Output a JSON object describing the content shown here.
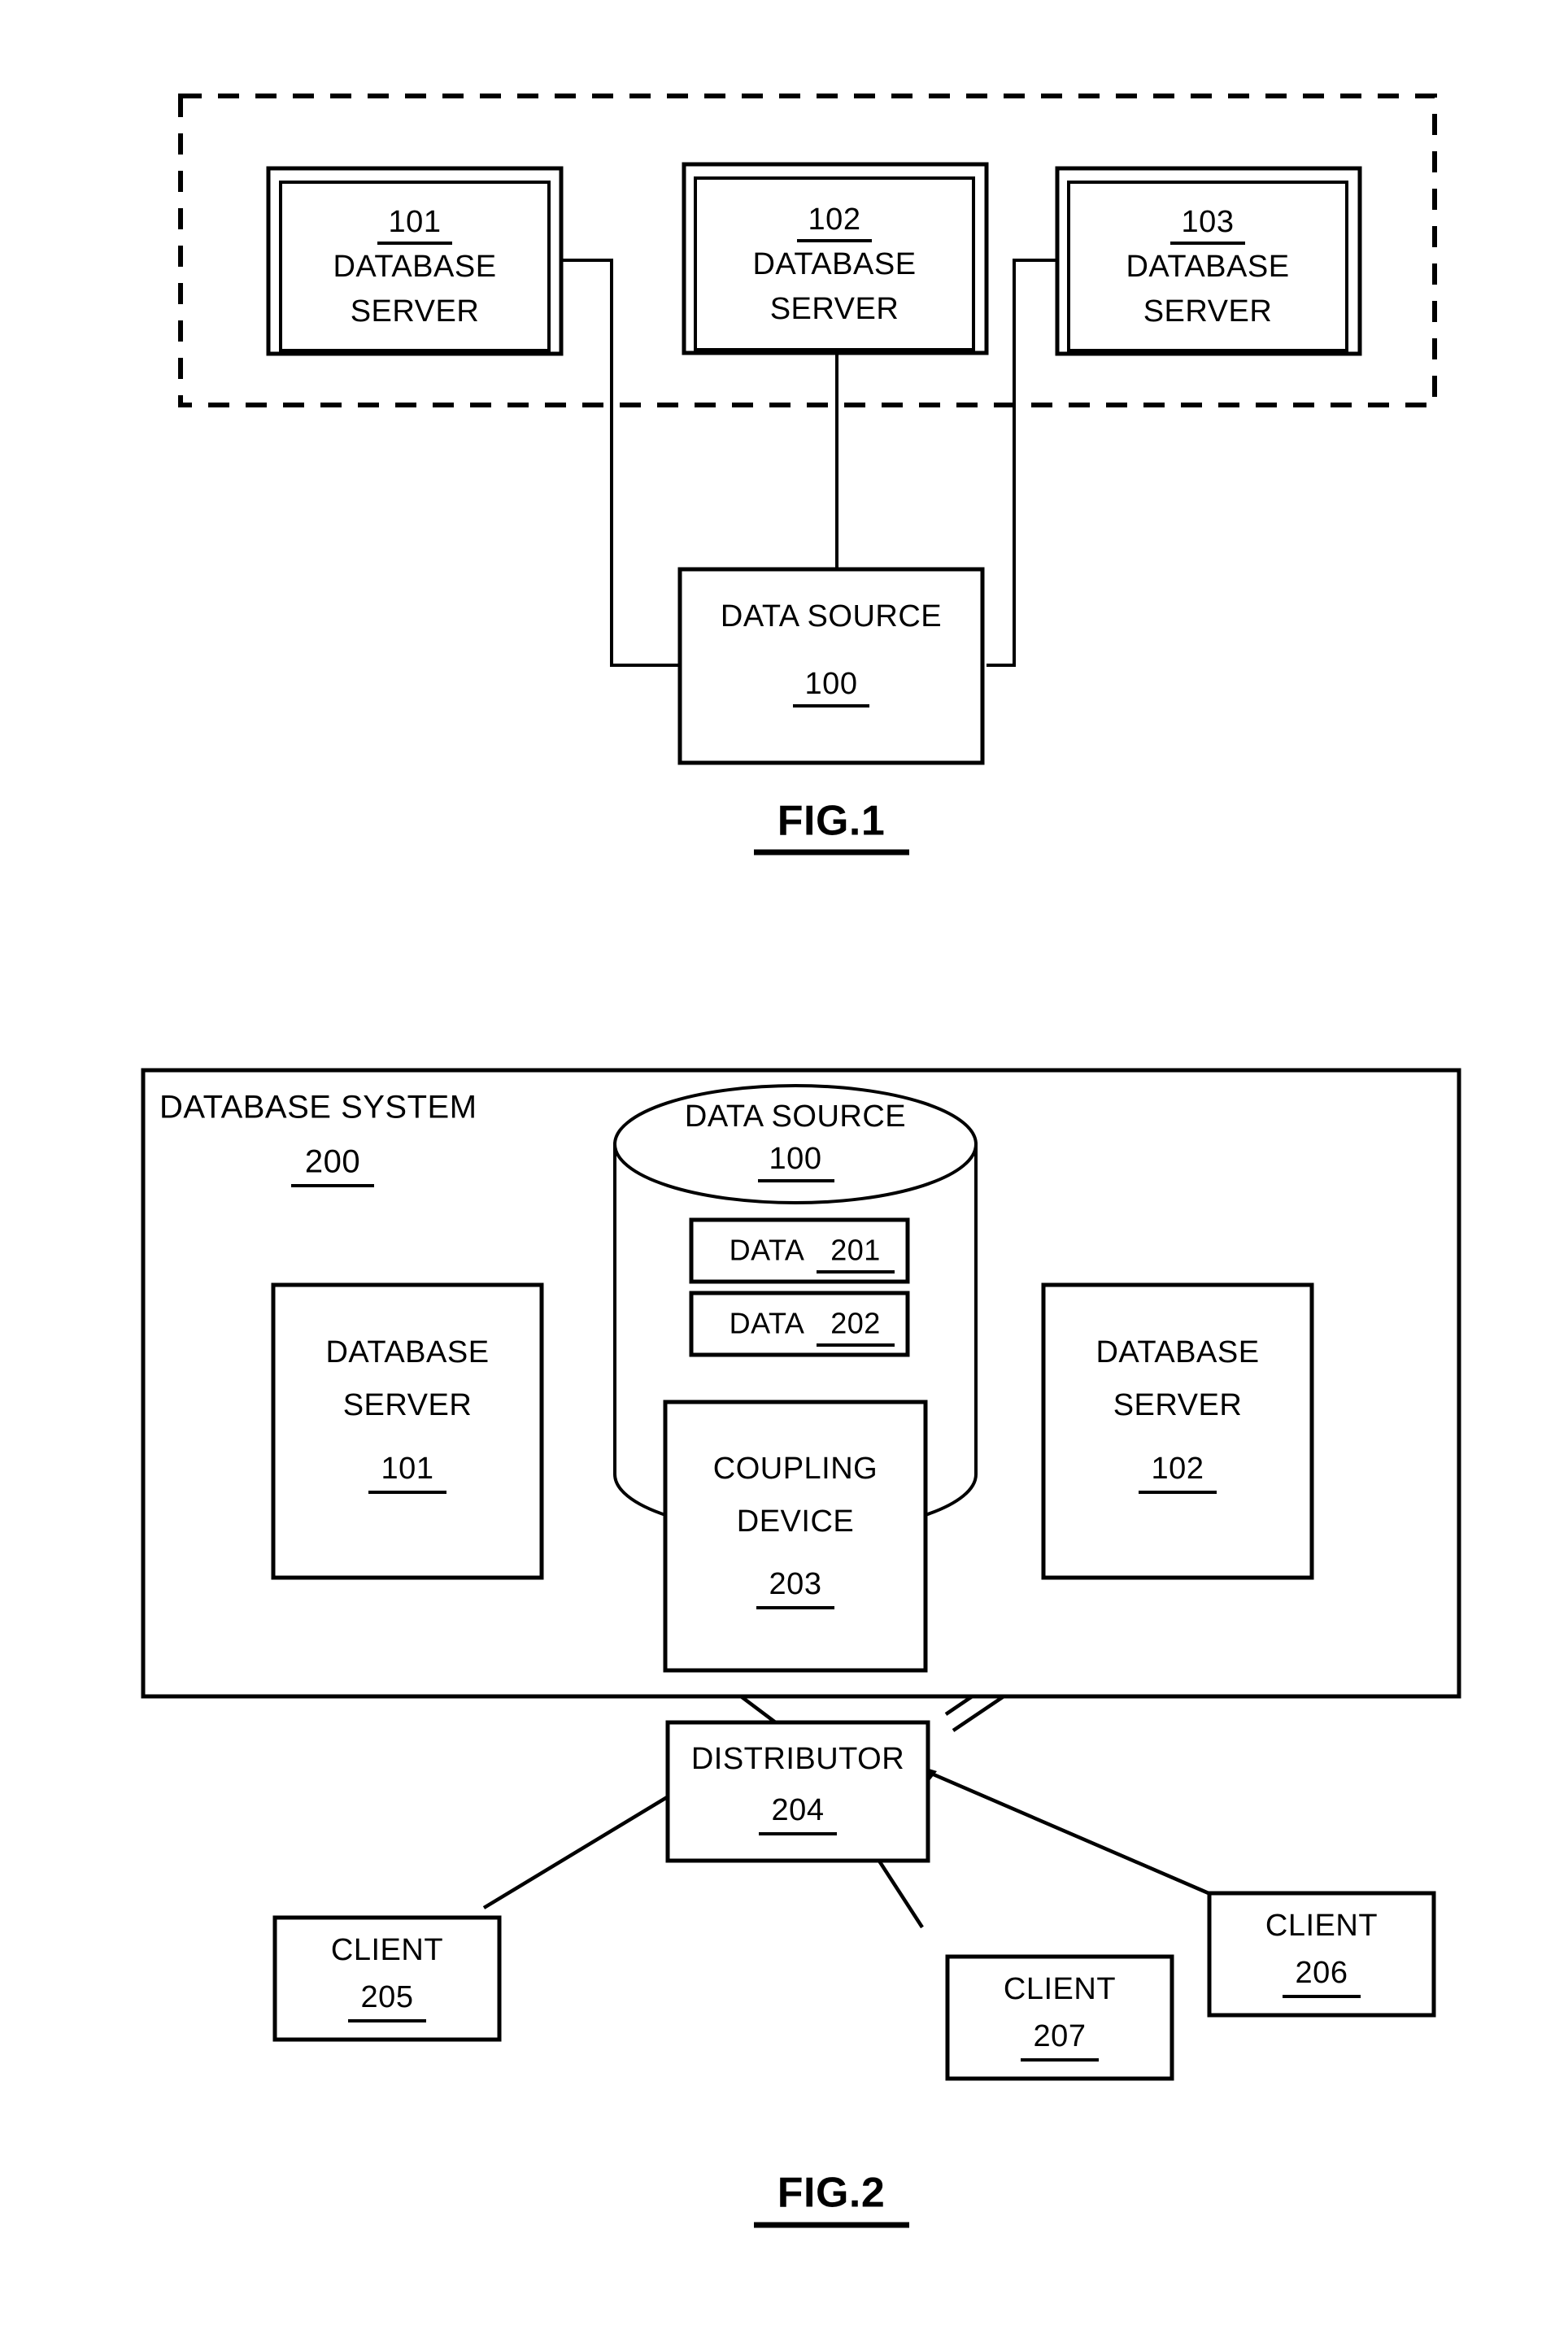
{
  "document": {
    "type": "patent-drawing-sheet",
    "background_color": "#ffffff",
    "ink_color": "#000000"
  },
  "figures": [
    {
      "id": "fig1",
      "caption": "FIG.1",
      "group_label": "",
      "nodes": [
        {
          "id": "srv101",
          "ref": "101",
          "line1": "DATABASE",
          "line2": "SERVER",
          "shape": "double-rect"
        },
        {
          "id": "srv102",
          "ref": "102",
          "line1": "DATABASE",
          "line2": "SERVER",
          "shape": "double-rect"
        },
        {
          "id": "srv103",
          "ref": "103",
          "line1": "DATABASE",
          "line2": "SERVER",
          "shape": "double-rect"
        },
        {
          "id": "ds100",
          "ref": "100",
          "line1": "DATA  SOURCE",
          "line2": "",
          "shape": "rect"
        }
      ],
      "edges": [
        {
          "from": "srv101",
          "to": "ds100",
          "style": "orthogonal",
          "arrow": "none"
        },
        {
          "from": "srv102",
          "to": "ds100",
          "style": "straight",
          "arrow": "none"
        },
        {
          "from": "srv103",
          "to": "ds100",
          "style": "orthogonal",
          "arrow": "none"
        }
      ]
    },
    {
      "id": "fig2",
      "caption": "FIG.2",
      "system": {
        "title": "DATABASE  SYSTEM",
        "ref": "200"
      },
      "nodes": [
        {
          "id": "ds100",
          "ref": "100",
          "line1": "DATA  SOURCE",
          "shape": "cylinder"
        },
        {
          "id": "data201",
          "label": "DATA",
          "ref": "201",
          "shape": "rect"
        },
        {
          "id": "data202",
          "label": "DATA",
          "ref": "202",
          "shape": "rect"
        },
        {
          "id": "srv101",
          "line1": "DATABASE",
          "line2": "SERVER",
          "ref": "101",
          "shape": "rect"
        },
        {
          "id": "srv102",
          "line1": "DATABASE",
          "line2": "SERVER",
          "ref": "102",
          "shape": "rect"
        },
        {
          "id": "coupling",
          "line1": "COUPLING",
          "line2": "DEVICE",
          "ref": "203",
          "shape": "rect"
        },
        {
          "id": "distributor",
          "line1": "DISTRIBUTOR",
          "ref": "204",
          "shape": "rect"
        },
        {
          "id": "client205",
          "line1": "CLIENT",
          "ref": "205",
          "shape": "rect"
        },
        {
          "id": "client206",
          "line1": "CLIENT",
          "ref": "206",
          "shape": "rect"
        },
        {
          "id": "client207",
          "line1": "CLIENT",
          "ref": "207",
          "shape": "rect"
        }
      ],
      "edges": [
        {
          "from": "srv101",
          "to": "data201",
          "arrow": "to"
        },
        {
          "from": "srv101",
          "to": "coupling",
          "arrow": "to"
        },
        {
          "from": "srv102",
          "to": "data201",
          "arrow": "to"
        },
        {
          "from": "srv102",
          "to": "data202",
          "arrow": "to"
        },
        {
          "from": "srv102",
          "to": "coupling",
          "arrow": "to"
        },
        {
          "from": "distributor",
          "to": "srv101",
          "arrow": "to"
        },
        {
          "from": "distributor",
          "to": "srv102",
          "arrow": "to"
        },
        {
          "from": "client205",
          "to": "distributor",
          "arrow": "to"
        },
        {
          "from": "client206",
          "to": "distributor",
          "arrow": "to"
        },
        {
          "from": "client207",
          "to": "distributor",
          "arrow": "to"
        }
      ]
    }
  ],
  "fig1": {
    "caption": "FIG.1",
    "servers": [
      {
        "ref": "101",
        "line1": "DATABASE",
        "line2": "SERVER"
      },
      {
        "ref": "102",
        "line1": "DATABASE",
        "line2": "SERVER"
      },
      {
        "ref": "103",
        "line1": "DATABASE",
        "line2": "SERVER"
      }
    ],
    "data_source": {
      "title": "DATA  SOURCE",
      "ref": "100"
    }
  },
  "fig2": {
    "caption": "FIG.2",
    "system_title": "DATABASE  SYSTEM",
    "system_ref": "200",
    "data_source": {
      "title": "DATA  SOURCE",
      "ref": "100"
    },
    "data_blocks": [
      {
        "label": "DATA",
        "ref": "201"
      },
      {
        "label": "DATA",
        "ref": "202"
      }
    ],
    "server_left": {
      "line1": "DATABASE",
      "line2": "SERVER",
      "ref": "101"
    },
    "server_right": {
      "line1": "DATABASE",
      "line2": "SERVER",
      "ref": "102"
    },
    "coupling_device": {
      "line1": "COUPLING",
      "line2": "DEVICE",
      "ref": "203"
    },
    "distributor": {
      "label": "DISTRIBUTOR",
      "ref": "204"
    },
    "clients": [
      {
        "label": "CLIENT",
        "ref": "205"
      },
      {
        "label": "CLIENT",
        "ref": "206"
      },
      {
        "label": "CLIENT",
        "ref": "207"
      }
    ]
  }
}
